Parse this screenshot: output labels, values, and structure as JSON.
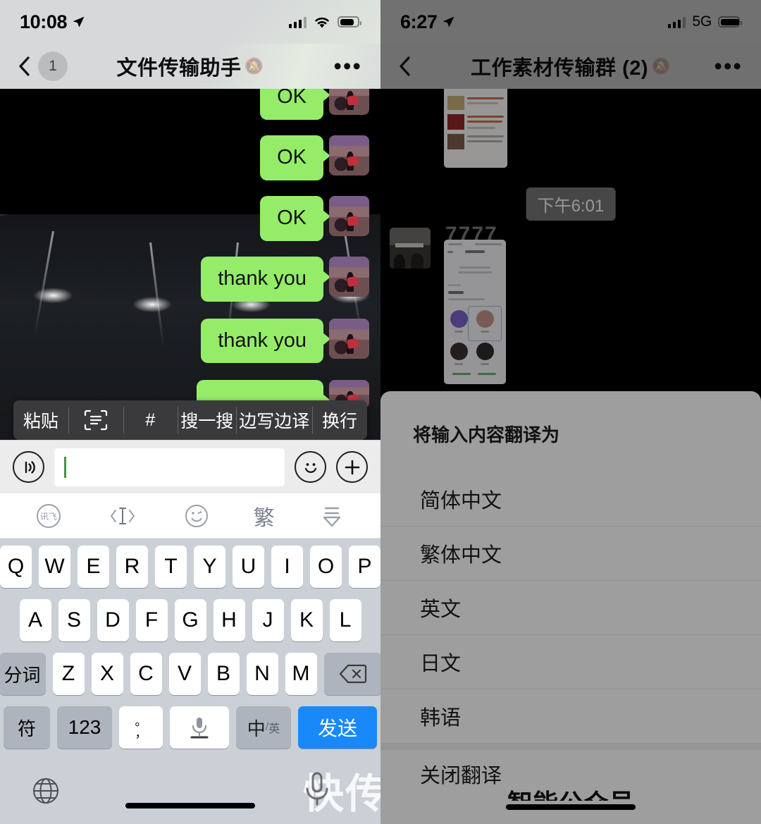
{
  "left_panel": {
    "status_bar": {
      "time": "10:08",
      "location_icon": "location-arrow-icon",
      "signal_icon": "cellular-bars-icon",
      "wifi_icon": "wifi-icon",
      "battery_icon": "battery-icon"
    },
    "nav_bar": {
      "back_icon": "chevron-left-icon",
      "back_badge": "1",
      "title": "文件传输助手",
      "mute_icon": "mute-bell-icon",
      "more_label": "•••"
    },
    "messages": [
      {
        "text": "OK",
        "side": "right"
      },
      {
        "text": "OK",
        "side": "right"
      },
      {
        "text": "OK",
        "side": "right"
      },
      {
        "text": "thank you",
        "side": "right"
      },
      {
        "text": "thank you",
        "side": "right"
      },
      {
        "text": "",
        "side": "right"
      }
    ],
    "long_press_toolbar": [
      {
        "label": "粘贴",
        "icon": ""
      },
      {
        "label": "",
        "icon": "scan-text-icon"
      },
      {
        "label": "#",
        "icon": ""
      },
      {
        "label": "搜一搜",
        "icon": ""
      },
      {
        "label": "边写边译",
        "icon": ""
      },
      {
        "label": "换行",
        "icon": ""
      }
    ],
    "input_bar": {
      "voice_icon": "voice-wave-icon",
      "input_value": "",
      "input_placeholder": "",
      "emoji_icon": "smiley-face-icon",
      "plus_icon": "plus-circle-icon"
    },
    "keyboard": {
      "toolbar": [
        {
          "icon": "ime-logo-icon",
          "label": "讯飞"
        },
        {
          "icon": "cursor-move-icon",
          "label": ""
        },
        {
          "icon": "emoji-wink-icon",
          "label": ""
        },
        {
          "icon": "",
          "label": "繁"
        },
        {
          "icon": "collapse-keyboard-icon",
          "label": ""
        }
      ],
      "row1": [
        "Q",
        "W",
        "E",
        "R",
        "T",
        "Y",
        "U",
        "I",
        "O",
        "P"
      ],
      "row2": [
        "A",
        "S",
        "D",
        "F",
        "G",
        "H",
        "J",
        "K",
        "L"
      ],
      "row3_left": "分词",
      "row3": [
        "Z",
        "X",
        "C",
        "V",
        "B",
        "N",
        "M"
      ],
      "row3_right_icon": "backspace-icon",
      "row4": {
        "symbol": "符",
        "numbers": "123",
        "punct_top": "。",
        "punct_bottom": "，",
        "space_icon": "microphone-icon",
        "lang_main": "中",
        "lang_sub": "英",
        "send": "发送"
      },
      "globe_icon": "globe-icon"
    },
    "watermark": "快传"
  },
  "right_panel": {
    "status_bar": {
      "time": "6:27",
      "location_icon": "location-arrow-icon",
      "signal_icon": "cellular-bars-icon",
      "network": "5G",
      "battery_icon": "battery-icon"
    },
    "nav_bar": {
      "back_icon": "chevron-left-icon",
      "title": "工作素材传输群 (2)",
      "mute_icon": "mute-bell-icon",
      "more_label": "•••"
    },
    "chat": {
      "timestamp_pill": "下午6:01",
      "text_message": "7777"
    },
    "action_sheet": {
      "title": "将输入内容翻译为",
      "options": [
        "简体中文",
        "繁体中文",
        "英文",
        "日文",
        "韩语"
      ],
      "close_option": "关闭翻译",
      "footer_text": "智能公众号"
    }
  },
  "colors": {
    "bubble_green": "#95EC69",
    "send_blue": "#1989FA",
    "keyboard_bg": "#CBD0D7",
    "key_fn": "#AEB4BD",
    "toolbar_dark": "#3A3A3C",
    "input_bar_bg": "#ECECEC"
  }
}
